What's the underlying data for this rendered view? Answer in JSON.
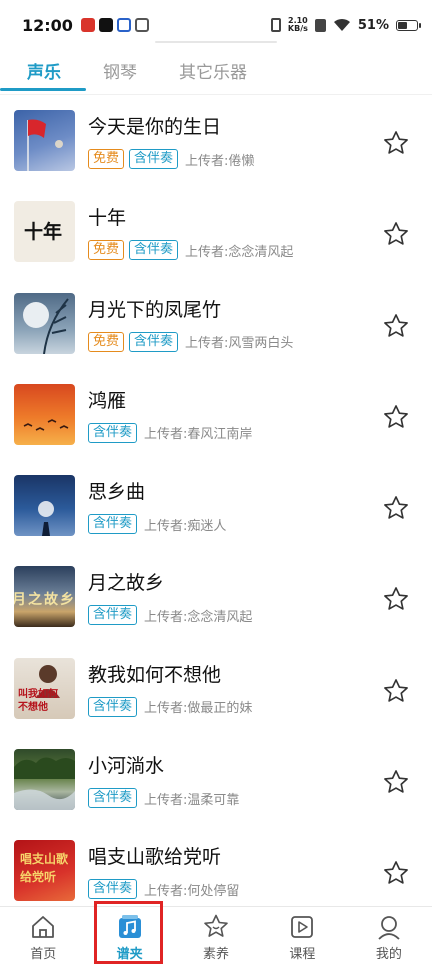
{
  "status_bar": {
    "time": "12:00",
    "speed_value": "2.10",
    "speed_unit": "KB/s",
    "battery_percent": "51%",
    "battery_level": 0.51
  },
  "tabs": [
    {
      "label": "声乐",
      "active": true
    },
    {
      "label": "钢琴",
      "active": false
    },
    {
      "label": "其它乐器",
      "active": false
    }
  ],
  "songs": [
    {
      "title": "今天是你的生日",
      "free": "免费",
      "accompaniment": "含伴奏",
      "uploader": "上传者:倦懒"
    },
    {
      "title": "十年",
      "free": "免费",
      "accompaniment": "含伴奏",
      "uploader": "上传者:念念清风起",
      "cover_text": "十年"
    },
    {
      "title": "月光下的凤尾竹",
      "free": "免费",
      "accompaniment": "含伴奏",
      "uploader": "上传者:风雪两白头"
    },
    {
      "title": "鸿雁",
      "accompaniment": "含伴奏",
      "uploader": "上传者:春风江南岸"
    },
    {
      "title": "思乡曲",
      "accompaniment": "含伴奏",
      "uploader": "上传者:痴迷人"
    },
    {
      "title": "月之故乡",
      "accompaniment": "含伴奏",
      "uploader": "上传者:念念清风起",
      "cover_text": "月之故乡"
    },
    {
      "title": "教我如何不想他",
      "accompaniment": "含伴奏",
      "uploader": "上传者:做最正的妹",
      "cover_text": "叫我如何不想他"
    },
    {
      "title": "小河淌水",
      "accompaniment": "含伴奏",
      "uploader": "上传者:温柔可靠"
    },
    {
      "title": "唱支山歌给党听",
      "accompaniment": "含伴奏",
      "uploader": "上传者:何处停留",
      "cover_text": "唱支山歌给党听"
    }
  ],
  "bottom_nav": [
    {
      "label": "首页",
      "icon": "home-icon"
    },
    {
      "label": "谱夹",
      "icon": "music-folder-icon",
      "active": true
    },
    {
      "label": "素养",
      "icon": "star-face-icon"
    },
    {
      "label": "课程",
      "icon": "play-course-icon"
    },
    {
      "label": "我的",
      "icon": "user-icon"
    }
  ],
  "colors": {
    "accent": "#1f9bc6",
    "free_tag": "#e58b1d",
    "highlight": "#e02424"
  }
}
